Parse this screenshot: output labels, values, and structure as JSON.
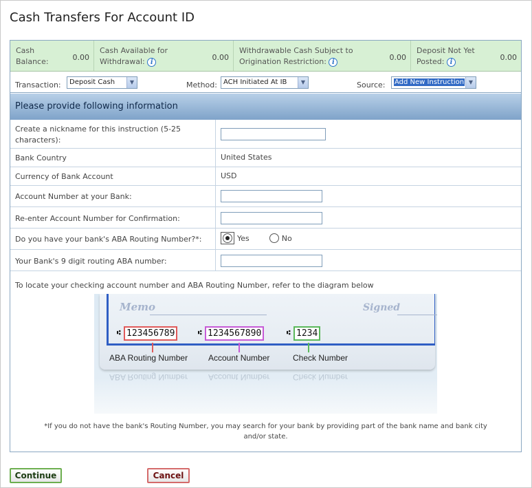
{
  "page": {
    "title": "Cash Transfers For Account ID"
  },
  "balances": [
    {
      "label_line1": "Cash",
      "label_line2": "Balance:",
      "value": "0.00",
      "has_info": false
    },
    {
      "label_line1": "Cash Available for",
      "label_line2": "Withdrawal:",
      "value": "0.00",
      "has_info": true
    },
    {
      "label_line1": "Withdrawable Cash Subject to",
      "label_line2": "Origination Restriction:",
      "value": "0.00",
      "has_info": true
    },
    {
      "label_line1": "Deposit Not Yet",
      "label_line2": "Posted:",
      "value": "0.00",
      "has_info": true
    }
  ],
  "selectors": {
    "transaction": {
      "label": "Transaction:",
      "value": "Deposit Cash"
    },
    "method": {
      "label": "Method:",
      "value": "ACH Initiated At IB"
    },
    "source": {
      "label": "Source:",
      "value": "Add New Instruction"
    }
  },
  "section": {
    "header": "Please provide following information"
  },
  "form": {
    "nickname": {
      "label_line1": "Create a nickname for this instruction (5-25",
      "label_line2": "characters):",
      "value": ""
    },
    "bank_country": {
      "label": "Bank Country",
      "value": "United States"
    },
    "currency": {
      "label": "Currency of Bank Account",
      "value": "USD"
    },
    "account_number": {
      "label": "Account Number at your Bank:",
      "value": ""
    },
    "account_confirm": {
      "label": "Re-enter Account Number for Confirmation:",
      "value": ""
    },
    "aba_question": {
      "label": "Do you have your bank's ABA Routing Number?*:",
      "yes_label": "Yes",
      "no_label": "No",
      "selected": "Yes"
    },
    "aba_number": {
      "label": "Your Bank's 9 digit routing ABA number:",
      "value": ""
    }
  },
  "diagram": {
    "intro": "To locate your checking account number and ABA Routing Number, refer to the diagram below",
    "memo": "Memo",
    "signed": "Signed",
    "routing_number": "123456789",
    "account_number": "1234567890",
    "check_number": "1234",
    "micr_symbol": "⑆",
    "routing_caption": "ABA Routing Number",
    "account_caption": "Account Number",
    "check_caption": "Check Number",
    "colors": {
      "routing": "#e05a5a",
      "account": "#c65ad6",
      "check": "#5ab85a",
      "band": "#2f5ec4"
    }
  },
  "footnote": {
    "line1": "*If you do not have the bank's Routing Number, you may search for your bank by providing part of the bank name and bank city",
    "line2": "and/or state."
  },
  "buttons": {
    "continue": "Continue",
    "cancel": "Cancel"
  }
}
